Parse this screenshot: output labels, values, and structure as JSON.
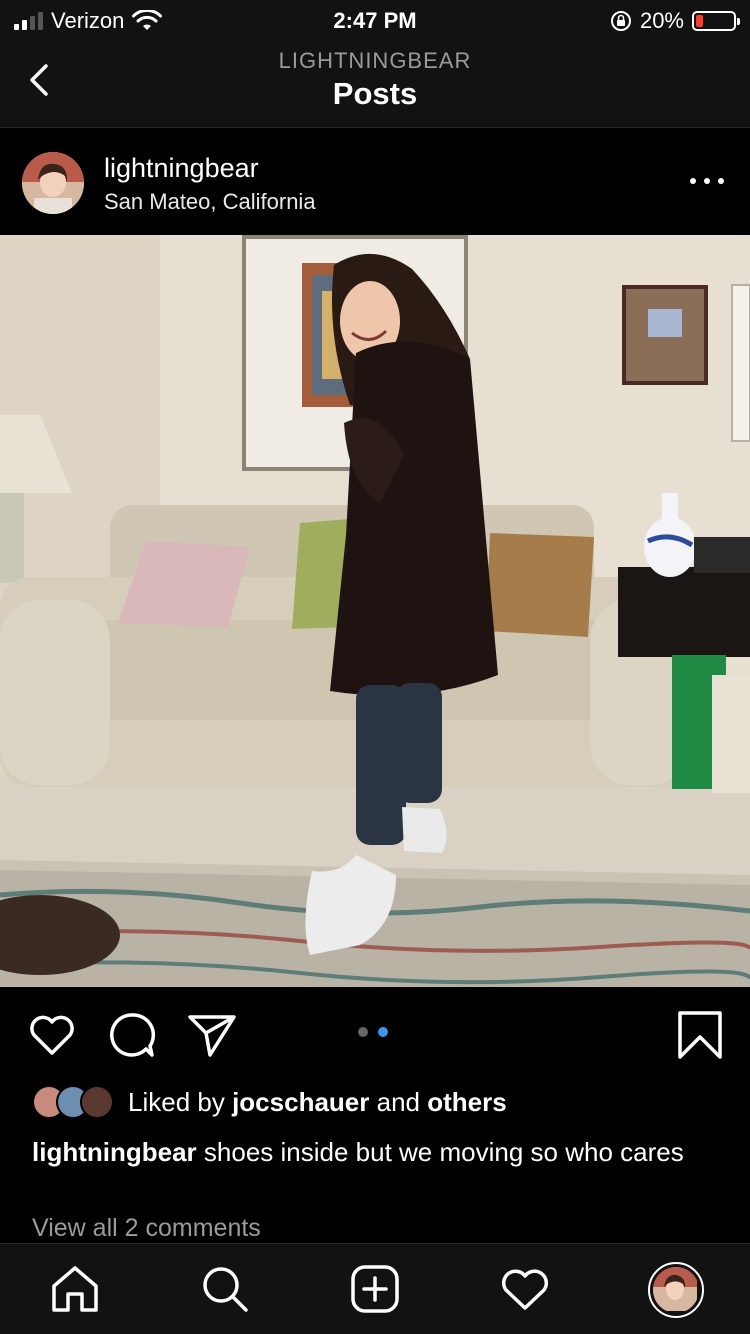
{
  "status_bar": {
    "carrier": "Verizon",
    "time": "2:47 PM",
    "battery_percent": "20%",
    "battery_level": 0.2,
    "icons": [
      "signal-icon",
      "wifi-icon",
      "orientation-lock-icon",
      "battery-icon"
    ]
  },
  "nav": {
    "subtitle": "LIGHTNINGBEAR",
    "title": "Posts"
  },
  "post": {
    "username": "lightningbear",
    "location": "San Mateo, California",
    "carousel": {
      "count": 2,
      "active_index": 1
    }
  },
  "likes": {
    "prefix": "Liked by ",
    "user": "jocschauer",
    "middle": " and ",
    "others": "others"
  },
  "caption": {
    "username": "lightningbear",
    "text": " shoes inside but we moving so who cares"
  },
  "comments_link": "View all 2 comments",
  "tab_bar": {
    "items": [
      "home-icon",
      "search-icon",
      "new-post-icon",
      "activity-icon",
      "profile-avatar"
    ]
  },
  "colors": {
    "background": "#000000",
    "bar": "#121212",
    "accent_blue": "#3897f0",
    "muted_text": "#9a9a9a",
    "battery_low": "#ff3b30"
  }
}
